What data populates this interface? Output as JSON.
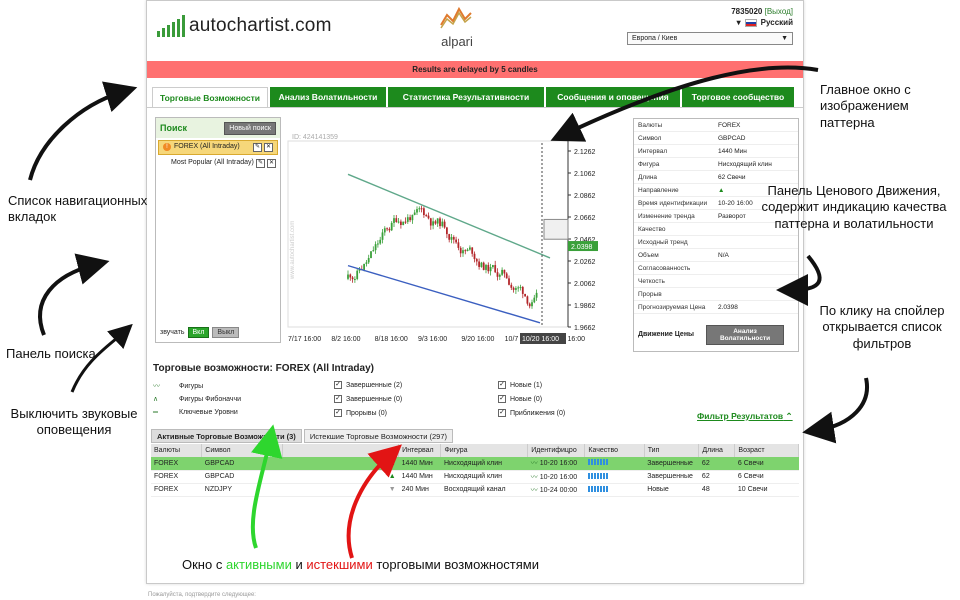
{
  "header": {
    "autochartist_logo": "autochartist.com",
    "alpari_logo": "alpari",
    "account_number": "7835020",
    "logout_label": "[Выход]",
    "language": "Русский",
    "timezone": "Европа / Киев"
  },
  "delay_banner": "Results are delayed by 5 candles",
  "tabs": [
    {
      "label": "Торговые Возможности",
      "active": true
    },
    {
      "label": "Анализ Волатильности",
      "active": false
    },
    {
      "label": "Статистика Результативности",
      "active": false
    },
    {
      "label": "Сообщения и оповещения",
      "active": false
    },
    {
      "label": "Торговое сообщество",
      "active": false
    }
  ],
  "search": {
    "title": "Поиск",
    "new_search_button": "Новый поиск",
    "items": [
      {
        "label": "FOREX (All Intraday)",
        "selected": true
      },
      {
        "label": "Most Popular (All Intraday)",
        "selected": false
      }
    ],
    "sound_label": "звучать",
    "sound_on": "Вкл",
    "sound_off": "Выкл"
  },
  "chart_data": {
    "type": "candlestick",
    "id_label": "ID: 424141359",
    "watermark": "www.autochartist.com",
    "x_ticks": [
      "7/17 16:00",
      "8/2 16:00",
      "8/18 16:00",
      "9/3 16:00",
      "9/20 16:00",
      "10/7 16:00",
      "10/20 16:00"
    ],
    "y_ticks": [
      "2.1262",
      "2.1062",
      "2.0862",
      "2.0662",
      "2.0462",
      "2.0262",
      "2.0062",
      "1.9862",
      "1.9662"
    ],
    "ylim": [
      1.9662,
      2.1262
    ],
    "current_price_label": "2.0398",
    "current_time_label": "10/20 16:00",
    "pattern": "Нисходящий клин",
    "up_color": "#3aa03a",
    "down_color": "#b3262a"
  },
  "info": {
    "rows": [
      {
        "k": "Валюты",
        "v": "FOREX"
      },
      {
        "k": "Символ",
        "v": "GBPCAD"
      },
      {
        "k": "Интервал",
        "v": "1440 Мин"
      },
      {
        "k": "Фигура",
        "v": "Нисходящий клин"
      },
      {
        "k": "Длина",
        "v": "62 Свечи"
      },
      {
        "k": "Направление",
        "v": "▲"
      },
      {
        "k": "Время идентификации",
        "v": "10-20 16:00"
      },
      {
        "k": "Изменение тренда",
        "v": "Разворот"
      },
      {
        "k": "Качество",
        "v": ""
      },
      {
        "k": "Исходный тренд",
        "v": ""
      },
      {
        "k": "Объем",
        "v": "N/A"
      },
      {
        "k": "Согласованность",
        "v": ""
      },
      {
        "k": "Четкость",
        "v": ""
      },
      {
        "k": "Прорыв",
        "v": ""
      },
      {
        "k": "Прогнозируемая Цена",
        "v": "2.0398"
      }
    ],
    "price_move_label": "Движение Цены",
    "volatility_button": "Анализ Волатильности"
  },
  "opportunities": {
    "title": "Торговые возможности: FOREX (All Intraday)",
    "filters": {
      "col1": [
        "Фигуры",
        "Фигуры Фибоначчи",
        "Ключевые Уровни"
      ],
      "col2": [
        "Завершенные (2)",
        "Завершенные (0)",
        "Прорывы (0)"
      ],
      "col3": [
        "Новые (1)",
        "Новые (0)",
        "Приближения (0)"
      ]
    },
    "filter_link": "Фильтр Результатов",
    "tabs": [
      "Активные Торговые Возможности (3)",
      "Истекшие Торговые Возможности (297)"
    ],
    "columns": [
      "Валюты",
      "Символ",
      "",
      "Интервал",
      "Фигура",
      "Идентифицро",
      "Качество",
      "Тип",
      "Длина",
      "Возраст"
    ],
    "rows": [
      {
        "cur": "FOREX",
        "sym": "GBPCAD",
        "dir": "▲",
        "int": "1440 Мин",
        "fig": "Нисходящий клин",
        "id": "10-20 16:00",
        "type": "Завершенные",
        "len": "62",
        "age": "6 Свечи",
        "hl": true
      },
      {
        "cur": "FOREX",
        "sym": "GBPCAD",
        "dir": "▲",
        "int": "1440 Мин",
        "fig": "Нисходящий клин",
        "id": "10-20 16:00",
        "type": "Завершенные",
        "len": "62",
        "age": "6 Свечи",
        "hl": false
      },
      {
        "cur": "FOREX",
        "sym": "NZDJPY",
        "dir": "▼",
        "int": "240 Мин",
        "fig": "Восходящий канал",
        "id": "10-24 00:00",
        "type": "Новые",
        "len": "48",
        "age": "10 Свечи",
        "hl": false
      }
    ]
  },
  "annotations": {
    "main_window": "Главное окно с изображением паттерна",
    "price_panel": "Панель Ценового Движения, содержит индикацию качества паттерна и волатильности",
    "nav_tabs": "Список навигационных вкладок",
    "search_panel": "Панель поиска",
    "sound": "Выключить звуковые оповещения",
    "spoiler": "По клику на спойлер открывается список фильтров",
    "bottom_pre": "Окно с ",
    "bottom_active": "активными",
    "bottom_mid": " и ",
    "bottom_expired": "истекшими",
    "bottom_post": " торговыми возможностями"
  },
  "footer": "Пожалуйста, подтвердите следующее:"
}
